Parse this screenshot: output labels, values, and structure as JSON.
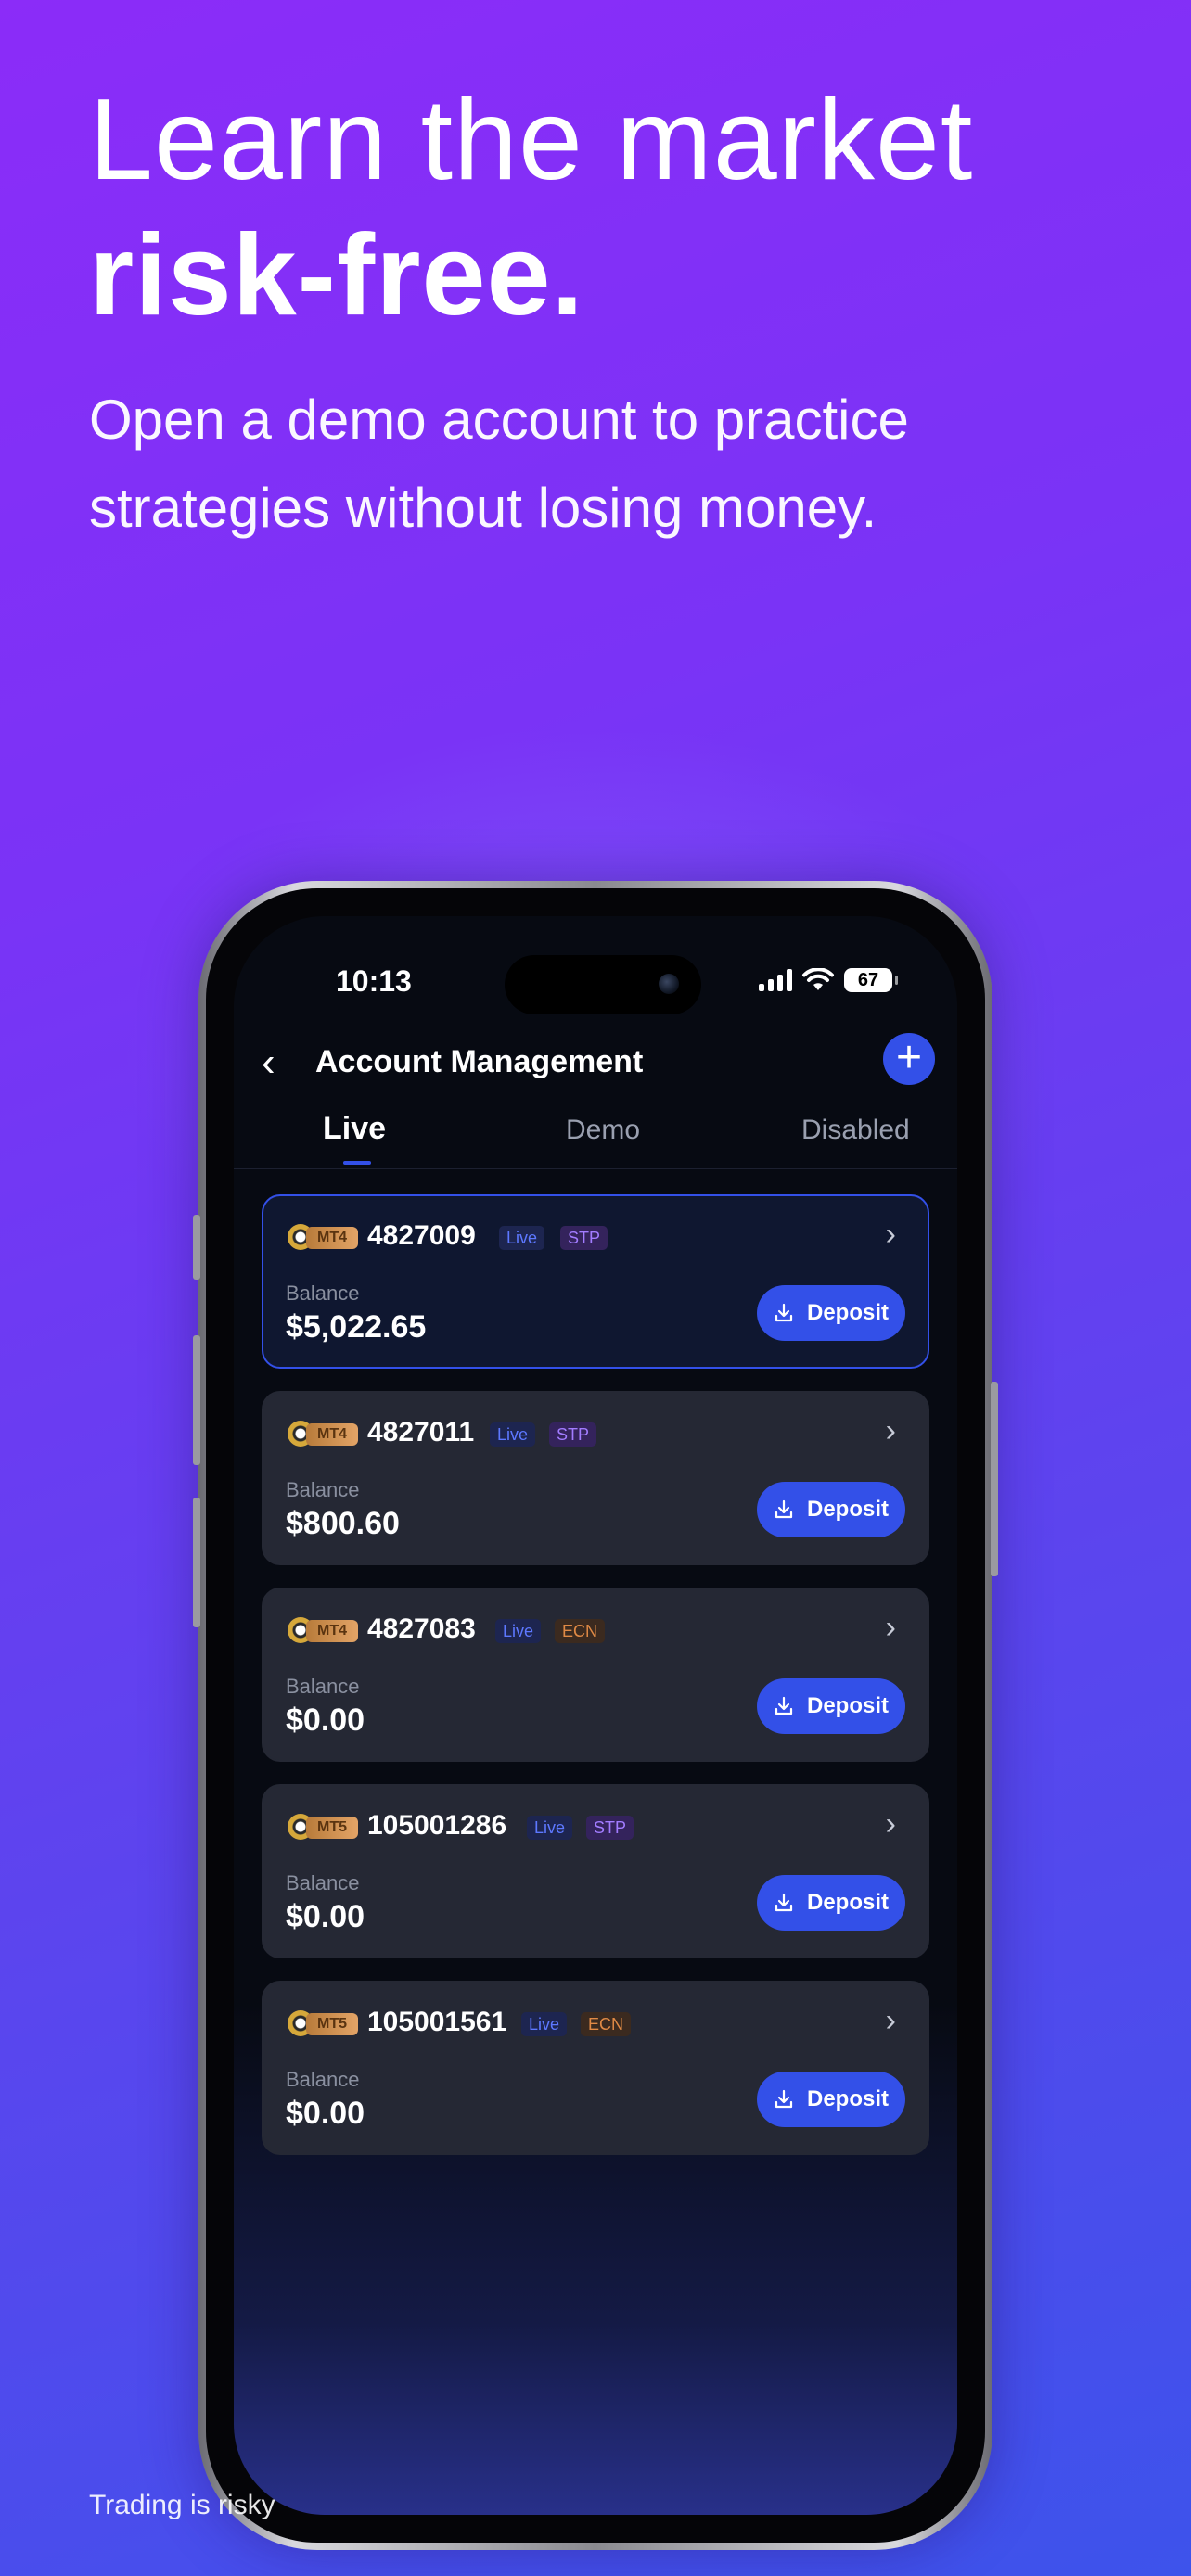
{
  "marketing": {
    "headline_line1": "Learn the market",
    "headline_line2": "risk-free.",
    "subline": "Open a demo account to practice strategies without losing money.",
    "disclaimer": "Trading is risky"
  },
  "status_bar": {
    "time": "10:13",
    "battery": "67",
    "icons": [
      "signal-icon",
      "wifi-icon",
      "battery-icon"
    ]
  },
  "nav": {
    "back_icon": "chevron-left-icon",
    "title": "Account Management",
    "add_icon": "plus-icon"
  },
  "tabs": [
    {
      "label": "Live",
      "active": true
    },
    {
      "label": "Demo",
      "active": false
    },
    {
      "label": "Disabled",
      "active": false
    }
  ],
  "accounts": [
    {
      "platform": "MT4",
      "number": "4827009",
      "type": "Live",
      "model": "STP",
      "balance_label": "Balance",
      "balance": "$5,022.65",
      "deposit_label": "Deposit",
      "selected": true
    },
    {
      "platform": "MT4",
      "number": "4827011",
      "type": "Live",
      "model": "STP",
      "balance_label": "Balance",
      "balance": "$800.60",
      "deposit_label": "Deposit",
      "selected": false
    },
    {
      "platform": "MT4",
      "number": "4827083",
      "type": "Live",
      "model": "ECN",
      "balance_label": "Balance",
      "balance": "$0.00",
      "deposit_label": "Deposit",
      "selected": false
    },
    {
      "platform": "MT5",
      "number": "105001286",
      "type": "Live",
      "model": "STP",
      "balance_label": "Balance",
      "balance": "$0.00",
      "deposit_label": "Deposit",
      "selected": false
    },
    {
      "platform": "MT5",
      "number": "105001561",
      "type": "Live",
      "model": "ECN",
      "balance_label": "Balance",
      "balance": "$0.00",
      "deposit_label": "Deposit",
      "selected": false
    }
  ],
  "colors": {
    "accent": "#3350e8",
    "live_pill": "#5d78ff",
    "stp_pill": "#a27cff",
    "ecn_pill": "#e08a45"
  }
}
